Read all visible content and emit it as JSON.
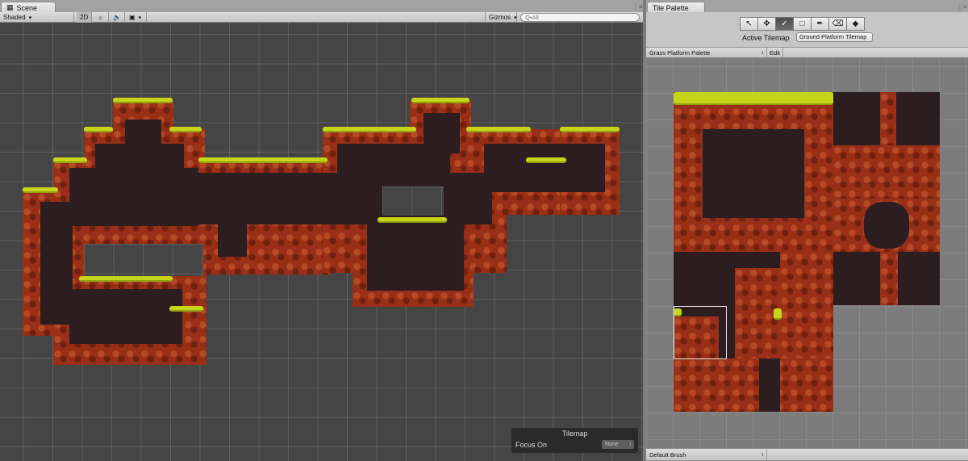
{
  "scene": {
    "tab_label": "Scene",
    "draw_mode": "Shaded",
    "toggle_2d": "2D",
    "gizmos_label": "Gizmos",
    "search_placeholder": "Q•All"
  },
  "tilemap_overlay": {
    "title": "Tilemap",
    "focus_label": "Focus On",
    "focus_value": "None"
  },
  "palette": {
    "tab_label": "Tile Palette",
    "active_tilemap_label": "Active Tilemap",
    "active_tilemap_value": "Ground Platform Tilemap",
    "palette_name": "Grass Platform Palette",
    "edit_label": "Edit",
    "brush_name": "Default Brush",
    "tools": [
      "select-tool",
      "move-tool",
      "paint-brush-tool",
      "box-fill-tool",
      "picker-tool",
      "eraser-tool",
      "fill-bucket-tool"
    ],
    "active_tool": "paint-brush-tool"
  },
  "colors": {
    "grass": "#c7d51a",
    "rock": "#982f16",
    "cave": "#2b1d20",
    "scene_bg": "#454545",
    "palette_bg": "#7c7c7c"
  }
}
